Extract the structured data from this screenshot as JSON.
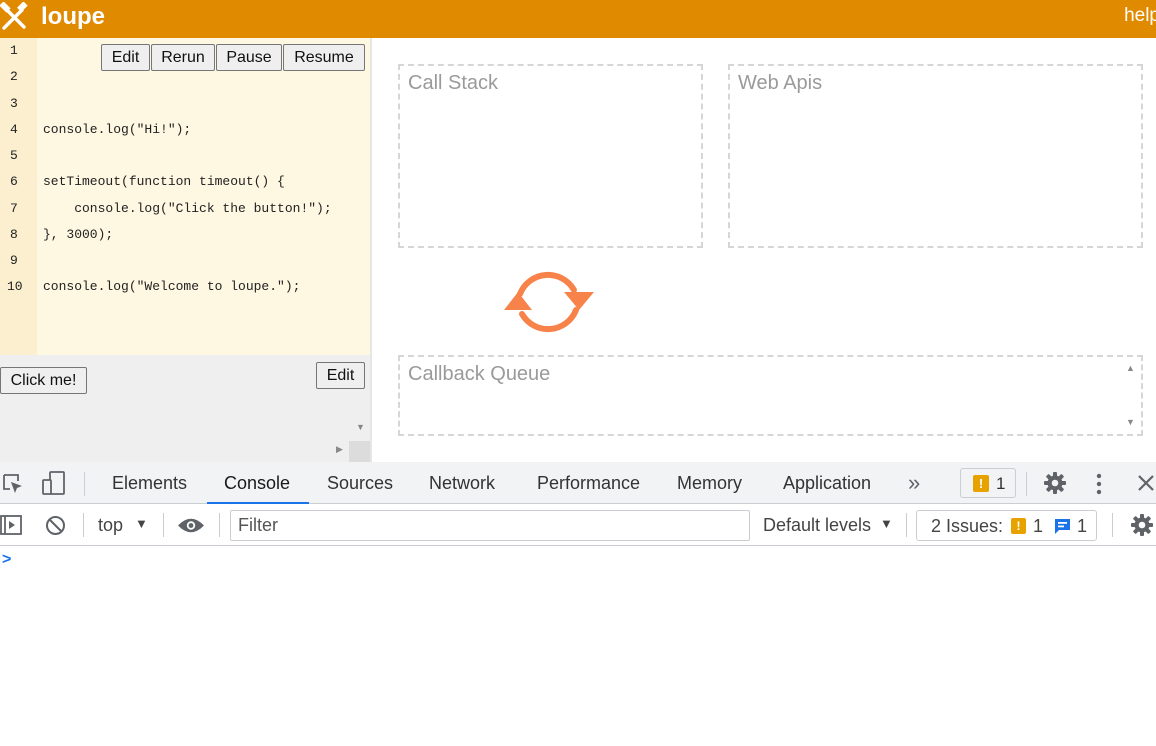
{
  "header": {
    "title": "loupe",
    "help": "help"
  },
  "editor": {
    "buttons": {
      "edit": "Edit",
      "rerun": "Rerun",
      "pause": "Pause",
      "resume": "Resume"
    },
    "line_numbers": [
      "1",
      "2",
      "3",
      "4",
      "5",
      "6",
      "7",
      "8",
      "9",
      "10"
    ],
    "code_lines": [
      "",
      "",
      "",
      "console.log(\"Hi!\");",
      "",
      "setTimeout(function timeout() {",
      "    console.log(\"Click the button!\");",
      "}, 3000);",
      "",
      "console.log(\"Welcome to loupe.\");"
    ]
  },
  "html_preview": {
    "click_button": "Click me!",
    "edit_button": "Edit"
  },
  "event_loop": {
    "call_stack": "Call Stack",
    "web_apis": "Web Apis",
    "callback_queue": "Callback Queue"
  },
  "devtools": {
    "tabs": [
      "Elements",
      "Console",
      "Sources",
      "Network",
      "Performance",
      "Memory",
      "Application"
    ],
    "active_tab": "Console",
    "warning_count": "1",
    "toolbar": {
      "context": "top",
      "filter_placeholder": "Filter",
      "levels": "Default levels",
      "issues_label": "2 Issues:",
      "issues_warning": "1",
      "issues_info": "1"
    },
    "prompt": ">"
  },
  "colors": {
    "accent": "#e08a00",
    "loop": "#f7834a",
    "devtools_blue": "#1a73e8",
    "warning": "#e8a200"
  }
}
